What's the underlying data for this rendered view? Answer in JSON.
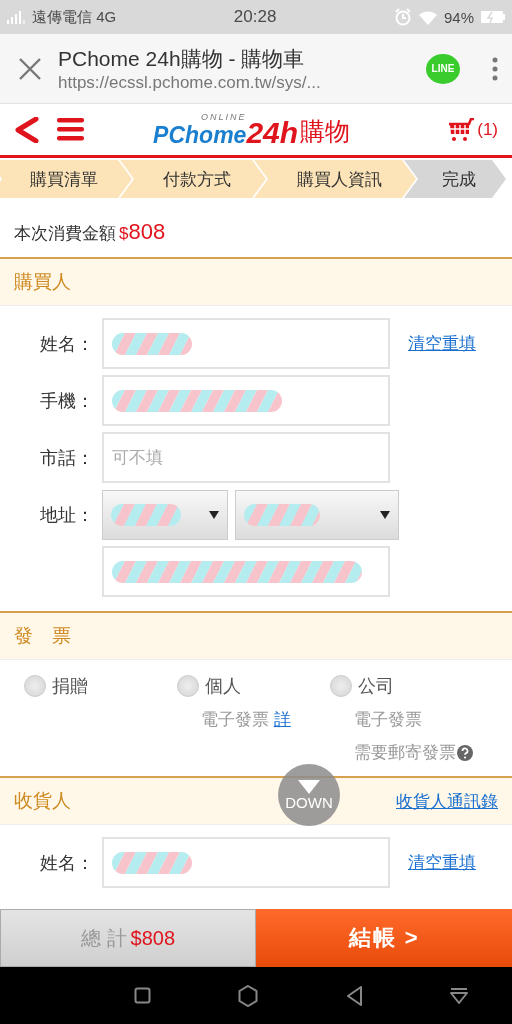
{
  "status_bar": {
    "carrier": "遠傳電信 4G",
    "time": "20:28",
    "battery": "94%"
  },
  "browser": {
    "title": "PChome 24h購物 - 購物車",
    "url": "https://ecssl.pchome.com.tw/sys/...",
    "share_badge": "LINE"
  },
  "header": {
    "logo": {
      "brand": "PChome",
      "tagline": "ONLINE",
      "hours": "24h",
      "suffix": "購物"
    },
    "cart_count": "(1)"
  },
  "steps": [
    {
      "label": "購買清單",
      "reached": true
    },
    {
      "label": "付款方式",
      "reached": true
    },
    {
      "label": "購買人資訊",
      "reached": true
    },
    {
      "label": "完成",
      "reached": false
    }
  ],
  "order_total": {
    "label": "本次消費金額",
    "currency": "$",
    "amount": "808"
  },
  "buyer": {
    "title": "購買人",
    "rows": [
      {
        "kind": "field",
        "label": "姓名：",
        "redacted": true,
        "link": "清空重填"
      },
      {
        "kind": "field",
        "label": "手機：",
        "redacted": true
      },
      {
        "kind": "field",
        "label": "市話：",
        "redacted": false,
        "placeholder": "可不填"
      },
      {
        "kind": "selects",
        "label": "地址：",
        "selects": [
          {
            "redacted": true
          },
          {
            "redacted": true
          }
        ]
      },
      {
        "kind": "field",
        "redacted": true
      }
    ]
  },
  "invoice": {
    "title": "發　票",
    "options": [
      {
        "label": "捐贈",
        "selected": false
      },
      {
        "label": "個人",
        "selected": false,
        "note": "電子發票",
        "note_link": "詳"
      },
      {
        "label": "公司",
        "selected": false,
        "note": "電子發票",
        "extra": "需要郵寄發票"
      }
    ]
  },
  "recipient": {
    "title": "收貨人",
    "link": "收貨人通訊錄",
    "rows": [
      {
        "kind": "field",
        "label": "姓名：",
        "redacted": true,
        "link": "清空重填"
      }
    ]
  },
  "scroll_button": "DOWN",
  "checkout": {
    "total_label": "總 計",
    "total": "$808",
    "button": "結帳 >"
  }
}
